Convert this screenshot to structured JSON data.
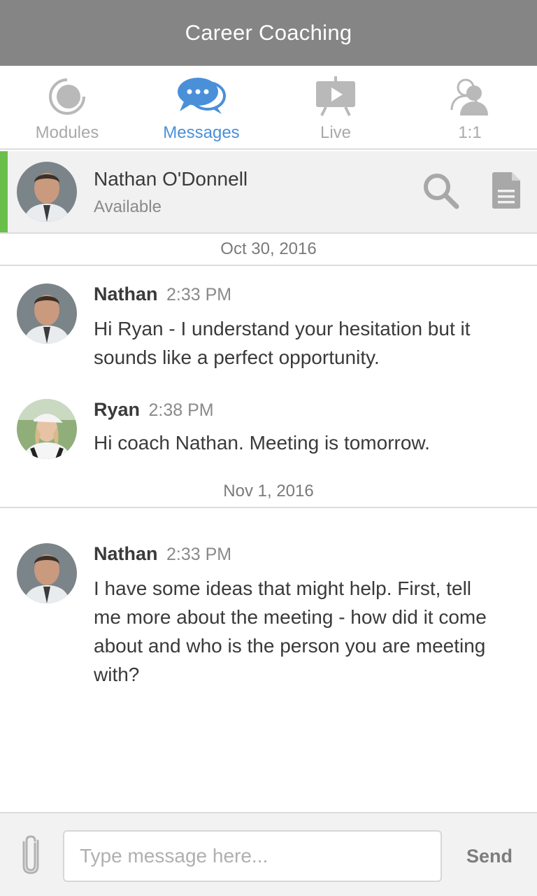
{
  "app": {
    "title": "Career Coaching"
  },
  "tabs": [
    {
      "label": "Modules",
      "icon": "modules-icon",
      "active": false
    },
    {
      "label": "Messages",
      "icon": "chat-bubbles-icon",
      "active": true
    },
    {
      "label": "Live",
      "icon": "presentation-play-icon",
      "active": false
    },
    {
      "label": "1:1",
      "icon": "users-icon",
      "active": false
    }
  ],
  "contact": {
    "name": "Nathan O'Donnell",
    "status": "Available",
    "status_color": "#6abf4b"
  },
  "conversation": {
    "date_1": "Oct 30, 2016",
    "date_2": "Nov 1, 2016",
    "messages": [
      {
        "sender": "Nathan",
        "time": "2:33 PM",
        "text": "Hi Ryan - I understand your hesitation but it sounds like a perfect opportunity."
      },
      {
        "sender": "Ryan",
        "time": "2:38 PM",
        "text": "Hi coach Nathan. Meeting is tomorrow."
      },
      {
        "sender": "Nathan",
        "time": "2:33 PM",
        "text": "I have some ideas that might help. First, tell me more about the meeting - how did it come about and who is the person you are meeting with?"
      }
    ]
  },
  "composer": {
    "placeholder": "Type message here...",
    "send_label": "Send"
  },
  "colors": {
    "header_bg": "#858585",
    "accent": "#4a90d9",
    "inactive_tab": "#a9a9a9"
  }
}
